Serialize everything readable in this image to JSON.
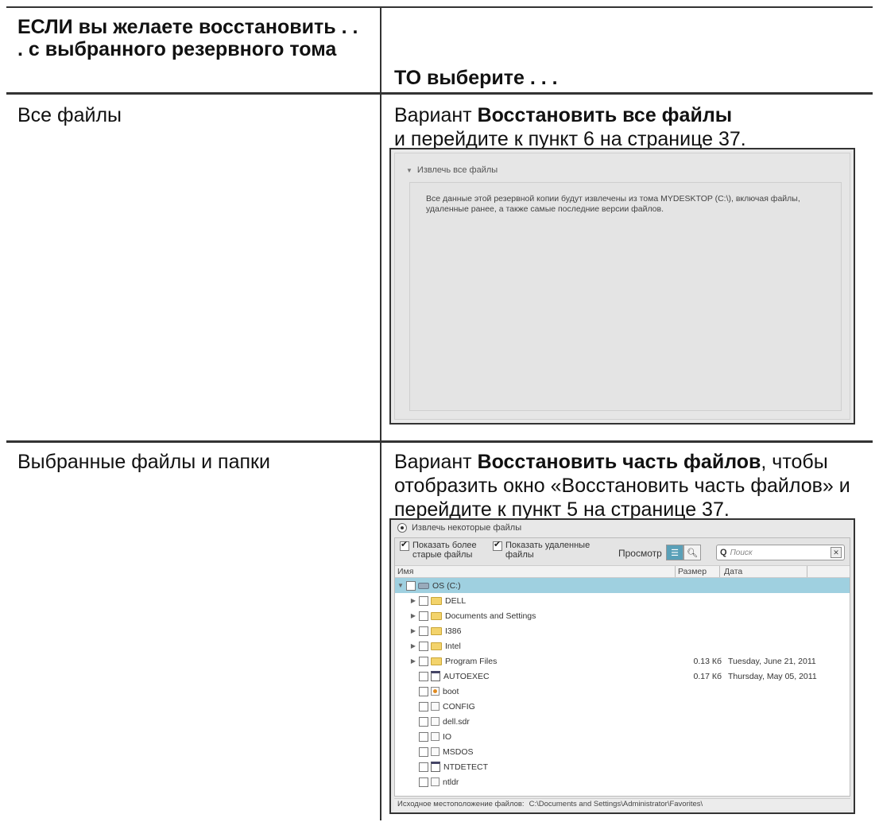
{
  "table": {
    "header_if": "ЕСЛИ вы желаете восстановить . . . с выбранного резервного тома",
    "header_then": "ТО выберите . . .",
    "rows": [
      {
        "if": "Все файлы",
        "then_prefix": "Вариант ",
        "then_bold": "Восстановить все файлы",
        "then_suffix": "",
        "then_next": "и перейдите к пункт 6 на странице 37."
      },
      {
        "if": "Выбранные файлы и папки",
        "then_prefix": "Вариант ",
        "then_bold": "Восстановить часть файлов",
        "then_suffix": ", чтобы отобразить окно «Восстановить часть файлов» и перейдите к пункт 5 на странице 37.",
        "then_next": ""
      }
    ]
  },
  "screenshot_all": {
    "section_title": "Извлечь все файлы",
    "description": "Все данные этой резервной копии будут извлечены из тома MYDESKTOP (C:\\), включая файлы, удаленные ранее, а также самые последние версии файлов."
  },
  "screenshot_some": {
    "section_title": "Извлечь некоторые файлы",
    "opt_older": "Показать более старые файлы",
    "opt_deleted": "Показать удаленные файлы",
    "view_label": "Просмотр",
    "search_placeholder": "Поиск",
    "columns": {
      "name": "Имя",
      "size": "Размер",
      "date": "Дата"
    },
    "items": [
      {
        "name": "OS (C:)",
        "icon": "drive",
        "level": 0,
        "expand": "open",
        "size": "",
        "date": ""
      },
      {
        "name": "DELL",
        "icon": "folder",
        "level": 1,
        "expand": "closed",
        "size": "",
        "date": ""
      },
      {
        "name": "Documents and Settings",
        "icon": "folder",
        "level": 1,
        "expand": "closed",
        "size": "",
        "date": ""
      },
      {
        "name": "I386",
        "icon": "folder",
        "level": 1,
        "expand": "closed",
        "size": "",
        "date": ""
      },
      {
        "name": "Intel",
        "icon": "folder",
        "level": 1,
        "expand": "closed",
        "size": "",
        "date": ""
      },
      {
        "name": "Program Files",
        "icon": "folder",
        "level": 1,
        "expand": "closed",
        "size": "0.13 Кб",
        "date": "Tuesday, June 21, 2011"
      },
      {
        "name": "AUTOEXEC",
        "icon": "exe",
        "level": 1,
        "expand": "",
        "size": "0.17 Кб",
        "date": "Thursday, May 05, 2011"
      },
      {
        "name": "boot",
        "icon": "boot",
        "level": 1,
        "expand": "",
        "size": "",
        "date": ""
      },
      {
        "name": "CONFIG",
        "icon": "file",
        "level": 1,
        "expand": "",
        "size": "",
        "date": ""
      },
      {
        "name": "dell.sdr",
        "icon": "file",
        "level": 1,
        "expand": "",
        "size": "",
        "date": ""
      },
      {
        "name": "IO",
        "icon": "file",
        "level": 1,
        "expand": "",
        "size": "",
        "date": ""
      },
      {
        "name": "MSDOS",
        "icon": "file",
        "level": 1,
        "expand": "",
        "size": "",
        "date": ""
      },
      {
        "name": "NTDETECT",
        "icon": "exe",
        "level": 1,
        "expand": "",
        "size": "",
        "date": ""
      },
      {
        "name": "ntldr",
        "icon": "file",
        "level": 1,
        "expand": "",
        "size": "",
        "date": ""
      }
    ],
    "status_label": "Исходное местоположение файлов:",
    "status_value": "C:\\Documents and Settings\\Administrator\\Favorites\\"
  }
}
